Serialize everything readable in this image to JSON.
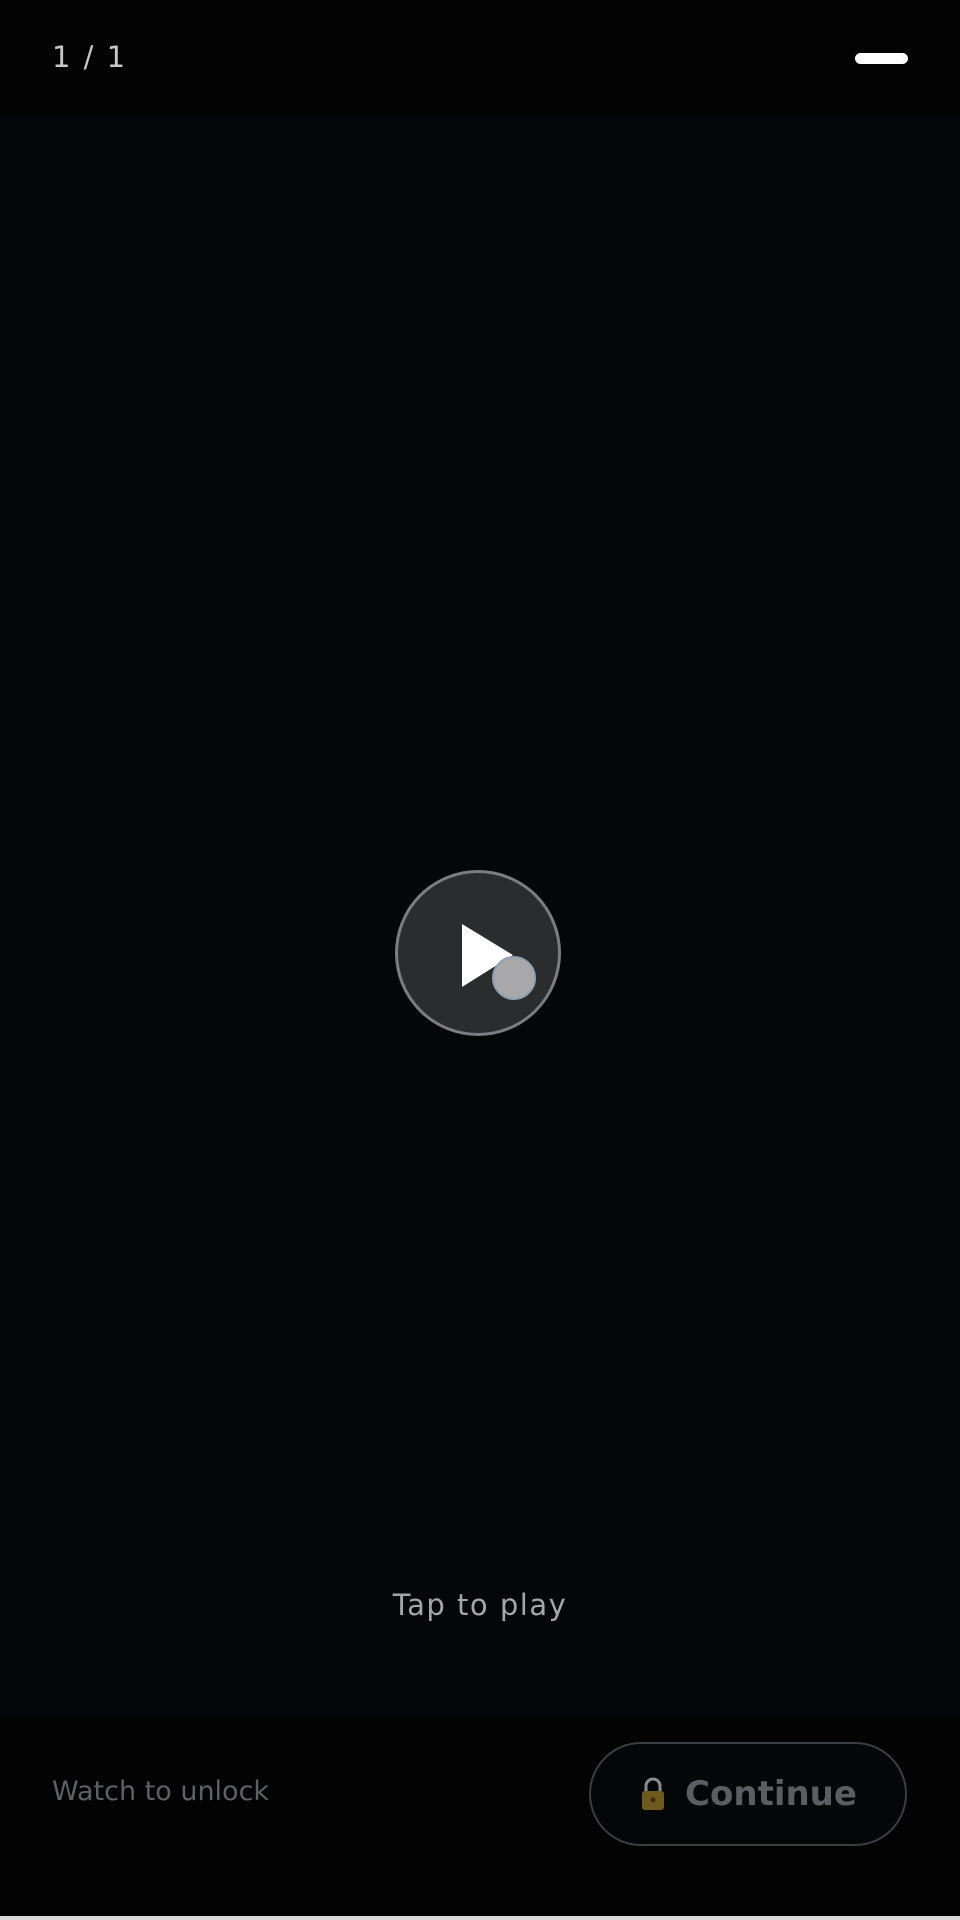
{
  "header": {
    "page_counter": "1 / 1"
  },
  "player": {
    "play_hint": "Tap to play"
  },
  "footer": {
    "unlock_hint": "Watch to unlock",
    "continue_label": "Continue",
    "continue_icon": "lock-icon"
  },
  "colors": {
    "background": "#050608",
    "play_button_fill": "#2a2c2e",
    "lock_icon": "#6e5a1c",
    "disabled_text": "#5b5d61"
  }
}
